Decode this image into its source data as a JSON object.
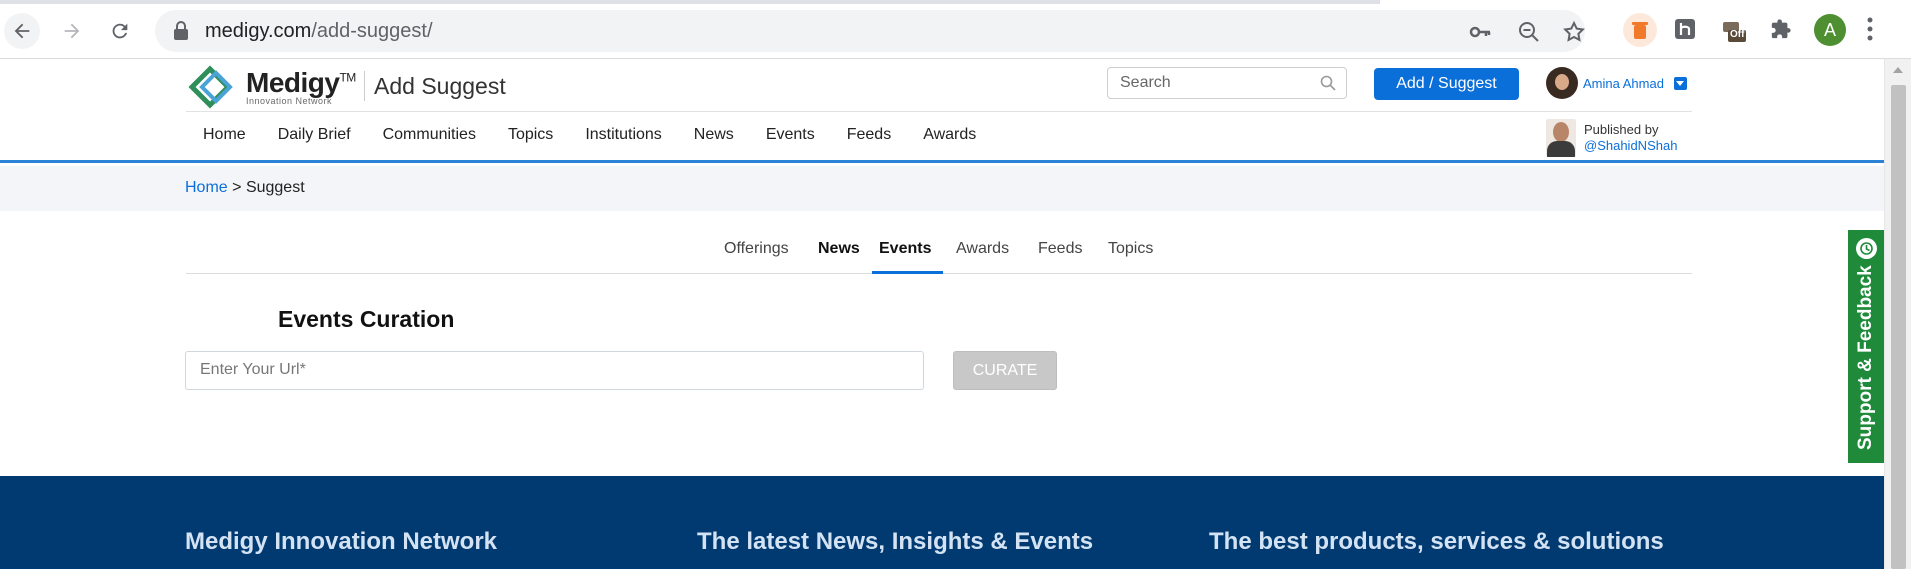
{
  "browser": {
    "url_domain": "medigy.com",
    "url_path": "/add-suggest/",
    "profile_initial": "A",
    "extension_badge": "Off"
  },
  "header": {
    "logo_name": "Medigy",
    "logo_tm": "TM",
    "logo_tagline": "Innovation Network",
    "page_heading": "Add Suggest",
    "search_placeholder": "Search",
    "add_button": "Add / Suggest",
    "user_name": "Amina Ahmad",
    "published_by_label": "Published by",
    "published_by_handle": "@ShahidNShah",
    "nav": [
      "Home",
      "Daily Brief",
      "Communities",
      "Topics",
      "Institutions",
      "News",
      "Events",
      "Feeds",
      "Awards"
    ]
  },
  "breadcrumb": {
    "home": "Home",
    "separator": ">",
    "current": "Suggest"
  },
  "tabs": {
    "items": [
      "Offerings",
      "News",
      "Events",
      "Awards",
      "Feeds",
      "Topics"
    ],
    "active": "Events"
  },
  "curation": {
    "title": "Events Curation",
    "url_placeholder": "Enter Your Url*",
    "curate_button": "CURATE"
  },
  "support": {
    "label": "Support & Feedback"
  },
  "footer": {
    "col1": "Medigy Innovation Network",
    "col2": "The latest News, Insights & Events",
    "col3": "The best products, services & solutions"
  },
  "colors": {
    "accent": "#0b6fd9",
    "support_green": "#1e8a3a",
    "footer_bg": "#003a70",
    "curate_disabled": "#c8c8c8"
  }
}
